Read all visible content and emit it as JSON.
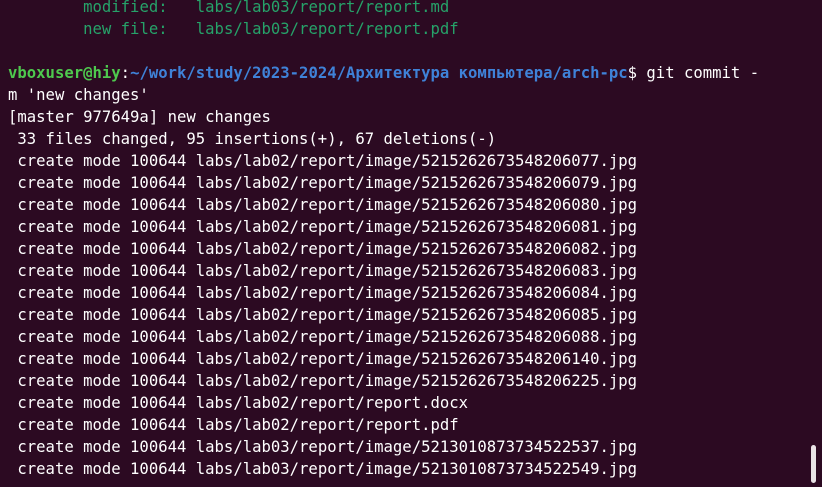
{
  "terminal": {
    "staged": [
      {
        "status": "modified:",
        "path": "labs/lab03/report/report.md"
      },
      {
        "status": "new file:",
        "path": "labs/lab03/report/report.pdf"
      }
    ],
    "prompt": {
      "user_host": "vboxuser@hiy",
      "separator": ":",
      "path": "~/work/study/2023-2024/Архитектура компьютера/arch-pc",
      "sign": "$",
      "command": " git commit -",
      "command_continued": "m 'new changes'"
    },
    "commit_header": "[master 977649a] new changes",
    "summary": " 33 files changed, 95 insertions(+), 67 deletions(-)",
    "create_prefix": " create mode 100644 ",
    "created_files": [
      "labs/lab02/report/image/5215262673548206077.jpg",
      "labs/lab02/report/image/5215262673548206079.jpg",
      "labs/lab02/report/image/5215262673548206080.jpg",
      "labs/lab02/report/image/5215262673548206081.jpg",
      "labs/lab02/report/image/5215262673548206082.jpg",
      "labs/lab02/report/image/5215262673548206083.jpg",
      "labs/lab02/report/image/5215262673548206084.jpg",
      "labs/lab02/report/image/5215262673548206085.jpg",
      "labs/lab02/report/image/5215262673548206088.jpg",
      "labs/lab02/report/image/5215262673548206140.jpg",
      "labs/lab02/report/image/5215262673548206225.jpg",
      "labs/lab02/report/report.docx",
      "labs/lab02/report/report.pdf",
      "labs/lab03/report/image/5213010873734522537.jpg",
      "labs/lab03/report/image/5213010873734522549.jpg"
    ],
    "colors": {
      "background": "#2c0a22",
      "text": "#ffffff",
      "git_status_green": "#26a269",
      "prompt_user": "#4ec94e",
      "prompt_path": "#3f82d8"
    }
  }
}
